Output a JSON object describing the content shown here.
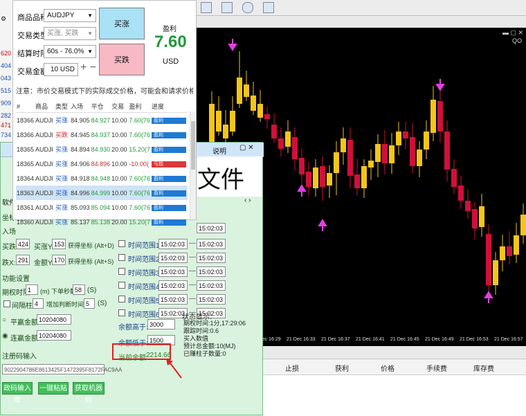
{
  "mt": {
    "left_prices": [
      "620",
      "404",
      "043",
      "515",
      "909",
      "282",
      "471",
      "734"
    ],
    "left_tab": "软件",
    "left_labels": [
      "坐标设",
      "入场",
      "买跌X:",
      "跌X:",
      "功能设置",
      "期权时限",
      "间隔柱子",
      "平赢金额",
      "连赢金额",
      "注册码输入"
    ],
    "chart_tag": "QO",
    "time_labels": [
      "21",
      "21 Dec 16:25",
      "21 Dec 16:29",
      "21 Dec 16:33",
      "21 Dec 16:37",
      "21 Dec 16:41",
      "21 Dec 16:45",
      "21 Dec 16:49",
      "21 Dec 16:53",
      "21 Dec 16:57"
    ],
    "terminal_headers": [
      "止损",
      "获利",
      "价格",
      "手续费",
      "库存费"
    ]
  },
  "panel": {
    "symbol_label": "商品品种",
    "symbol_value": "AUDJPY",
    "trade_type_label": "交易类型",
    "trade_type_value": "买涨, 买跌",
    "expiry_label": "结算时限",
    "expiry_value": "60s - 76.0%",
    "amount_label": "交易金额",
    "amount_value": "10 USD",
    "buy_up": "买涨",
    "buy_down": "买跌",
    "profit_label": "盈利",
    "profit_value": "7.60",
    "profit_unit": "USD",
    "notice": "注意：市价交易模式下的实际成交价格，可能会和请求价格有一定差异",
    "table_headers": [
      "#",
      "商品",
      "类型",
      "入场",
      "平仓",
      "交易",
      "盈利",
      "进度"
    ],
    "rows": [
      {
        "id": "18366",
        "sym": "AUDJI",
        "type": "买涨",
        "entry": "84.905",
        "close": "84.927",
        "amt": "10.00",
        "profit": "7.60(76",
        "prog": "盈利",
        "loss": false
      },
      {
        "id": "18366",
        "sym": "AUDJI",
        "type": "买跌",
        "entry": "84.945",
        "close": "84.937",
        "amt": "10.00",
        "profit": "7.60(76",
        "prog": "盈利",
        "loss": false
      },
      {
        "id": "18365",
        "sym": "AUDJI",
        "type": "买涨",
        "entry": "84.894",
        "close": "84.930",
        "amt": "20.00",
        "profit": "15.20(7",
        "prog": "盈利",
        "loss": false
      },
      {
        "id": "18365",
        "sym": "AUDJI",
        "type": "买涨",
        "entry": "84.906",
        "close": "84.896",
        "amt": "10.00",
        "profit": "-10.00(",
        "prog": "亏损",
        "loss": true
      },
      {
        "id": "18364",
        "sym": "AUDJI",
        "type": "买涨",
        "entry": "84.918",
        "close": "84.948",
        "amt": "10.00",
        "profit": "7.60(76",
        "prog": "盈利",
        "loss": false
      },
      {
        "id": "18363",
        "sym": "AUDJI",
        "type": "买涨",
        "entry": "84.996",
        "close": "84.999",
        "amt": "10.00",
        "profit": "7.60(76",
        "prog": "盈利",
        "loss": false
      },
      {
        "id": "18361",
        "sym": "AUDJI",
        "type": "买涨",
        "entry": "85.093",
        "close": "85.094",
        "amt": "10.00",
        "profit": "7.60(76",
        "prog": "盈利",
        "loss": false
      },
      {
        "id": "18360",
        "sym": "AUDJI",
        "type": "买涨",
        "entry": "85.137",
        "close": "85.138",
        "amt": "20.00",
        "profit": "15.20(7",
        "prog": "盈利",
        "loss": false
      }
    ]
  },
  "soft": {
    "title_text": "说明",
    "banner_text": "文件",
    "entry_x": "424",
    "entry_y_label": "买涨Y:",
    "entry_y": "153",
    "get_coord_1": "获得坐标 (Alt+D)",
    "down_x": "291",
    "down_y_label": "金额Y:",
    "down_y": "170",
    "get_coord_2": "获得坐标 (Alt+S)",
    "function_settings": "功能设置",
    "period_label": "期权时限",
    "period_value": "1",
    "period_unit": "(m) 下单秒数",
    "seconds_value": "58",
    "seconds_unit": "(S)",
    "interval_label": "间隔柱子",
    "interval_value": "4",
    "add_delay_label": "增加判断时间",
    "add_delay_value": "5",
    "add_delay_unit": "(S)",
    "flat_win_label": "平赢金额:",
    "flat_win_value": "10204080",
    "chain_win_label": "连赢金额:",
    "chain_win_value": "10204080",
    "reg_label": "注册码输入",
    "reg_code": "9022904786E8613425F1472395F8172FAC9AA",
    "btn_reg": "政码输入框",
    "btn_paste": "一键粘贴",
    "btn_machine": "获取机器码",
    "time_ranges": [
      {
        "label": "时间范围1",
        "from": "15:02:03",
        "to": "15:02:03"
      },
      {
        "label": "时间范围2",
        "from": "15:02:03",
        "to": "15:02:03"
      },
      {
        "label": "时间范围3",
        "from": "15:02:03",
        "to": "15:02:03"
      },
      {
        "label": "时间范围4",
        "from": "15:02:03",
        "to": "15:02:03"
      },
      {
        "label": "时间范围5",
        "from": "15:02:03",
        "to": "15:02:03"
      },
      {
        "label": "时间范围6",
        "from": "15:02:03",
        "to": "15:02:03"
      }
    ],
    "top_time_to": "15:02:03",
    "balance_high_label": "余额高于:",
    "balance_high_value": "3000",
    "balance_low_label": "余额低于:",
    "balance_low_value": "1500",
    "current_balance_label": "当前余额:",
    "current_balance_value": "2214.66",
    "status_title": "状态显示:",
    "status_lines": [
      "期权时间:1分,17:29:06",
      "跟踪时间:0.6",
      "买入数值",
      "预计总金额:10(MJ)",
      "已赚柱子数量:0"
    ]
  },
  "colors": {
    "bull": "#f5c518",
    "bear": "#d0103a",
    "arrow": "#e040e0",
    "green_bg": "#d9f3de"
  }
}
